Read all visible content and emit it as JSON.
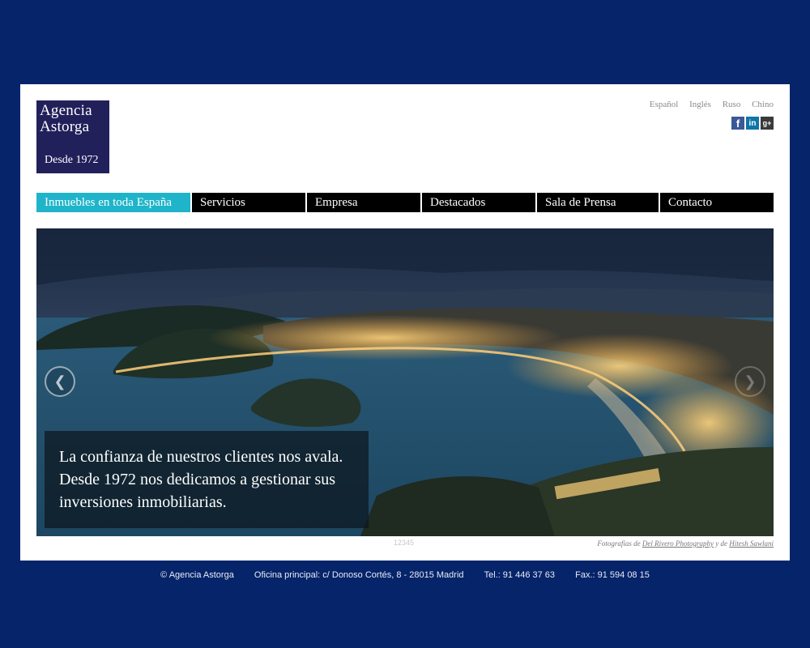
{
  "logo": {
    "line1": "Agencia",
    "line2": "Astorga",
    "line3": "Desde 1972"
  },
  "languages": [
    "Español",
    "Inglés",
    "Ruso",
    "Chino"
  ],
  "social": [
    {
      "name": "facebook-icon",
      "glyph": "f"
    },
    {
      "name": "linkedin-icon",
      "glyph": "in"
    },
    {
      "name": "google-plus-icon",
      "glyph": "g+"
    }
  ],
  "nav": [
    "Inmuebles en toda España",
    "Servicios",
    "Empresa",
    "Destacados",
    "Sala de Prensa",
    "Contacto"
  ],
  "hero": {
    "caption": "La confianza de nuestros clientes nos avala. Desde 1972 nos dedicamos a gestionar sus inversiones inmobiliarias.",
    "pager": "12345"
  },
  "credits": {
    "prefix": "Fotografías de",
    "link1": "Del Rivero Photography",
    "middle": "y de",
    "link2": "Hitesh Sawlani"
  },
  "footer": {
    "copyright": "© Agencia Astorga",
    "office": "Oficina principal: c/ Donoso Cortés, 8 - 28015 Madrid",
    "phone": "Tel.: 91 446 37 63",
    "fax": "Fax.: 91 594 08 15"
  },
  "colors": {
    "background": "#05246a",
    "accent": "#1fb4c9",
    "logo": "#22205a"
  }
}
